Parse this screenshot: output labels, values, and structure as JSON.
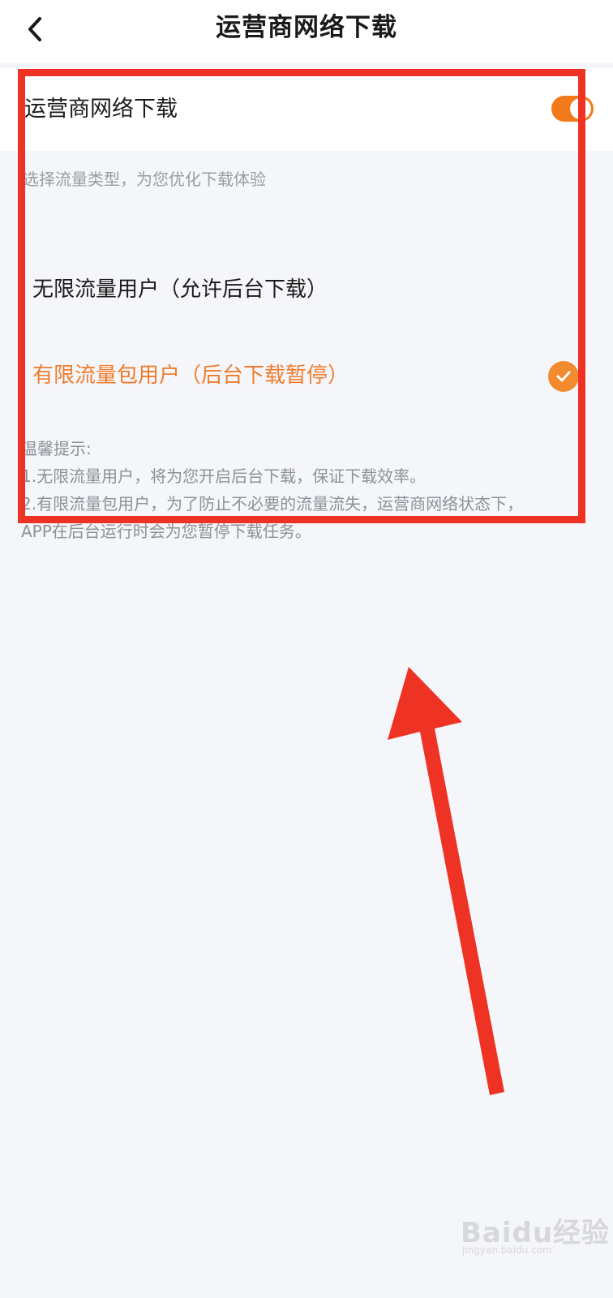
{
  "header": {
    "title": "运营商网络下载",
    "back_icon": "chevron-left-icon"
  },
  "main_toggle": {
    "label": "运营商网络下载",
    "enabled": true,
    "accent_color": "#f27a1b"
  },
  "subtitle": "选择流量类型，为您优化下载体验",
  "options": [
    {
      "label": "无限流量用户（允许后台下载）",
      "selected": false
    },
    {
      "label": "有限流量包用户（后台下载暂停）",
      "selected": true,
      "check_icon": "check-circle-icon"
    }
  ],
  "tips": {
    "heading": "温馨提示:",
    "lines": [
      "1.无限流量用户，将为您开启后台下载，保证下载效率。",
      "2.有限流量包用户，为了防止不必要的流量流失，运营商网络状态下，",
      "APP在后台运行时会为您暂停下载任务。"
    ]
  },
  "annotation": {
    "box_color": "#ee3324",
    "arrow_color": "#ee3324"
  },
  "watermark": {
    "text": "Baidu经验",
    "sub": "jingyan.baidu.com"
  }
}
